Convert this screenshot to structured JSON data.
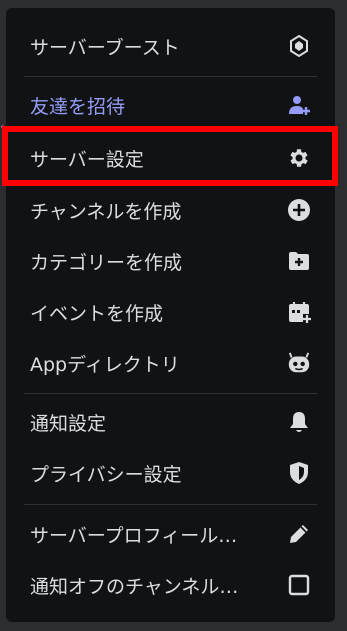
{
  "menu": {
    "items": [
      {
        "label": "サーバーブースト",
        "icon": "boost-gem-icon"
      },
      {
        "label": "友達を招待",
        "icon": "add-user-icon"
      },
      {
        "label": "サーバー設定",
        "icon": "gear-icon"
      },
      {
        "label": "チャンネルを作成",
        "icon": "plus-circle-icon"
      },
      {
        "label": "カテゴリーを作成",
        "icon": "folder-plus-icon"
      },
      {
        "label": "イベントを作成",
        "icon": "calendar-plus-icon"
      },
      {
        "label": "Appディレクトリ",
        "icon": "bot-icon"
      },
      {
        "label": "通知設定",
        "icon": "bell-icon"
      },
      {
        "label": "プライバシー設定",
        "icon": "shield-icon"
      },
      {
        "label": "サーバープロフィール…",
        "icon": "pencil-icon"
      },
      {
        "label": "通知オフのチャンネル…",
        "icon": "checkbox-icon"
      }
    ]
  },
  "colors": {
    "menu_bg": "#111214",
    "text": "#dbdee1",
    "invite_accent": "#949cf7",
    "highlight": "#ff0000"
  }
}
